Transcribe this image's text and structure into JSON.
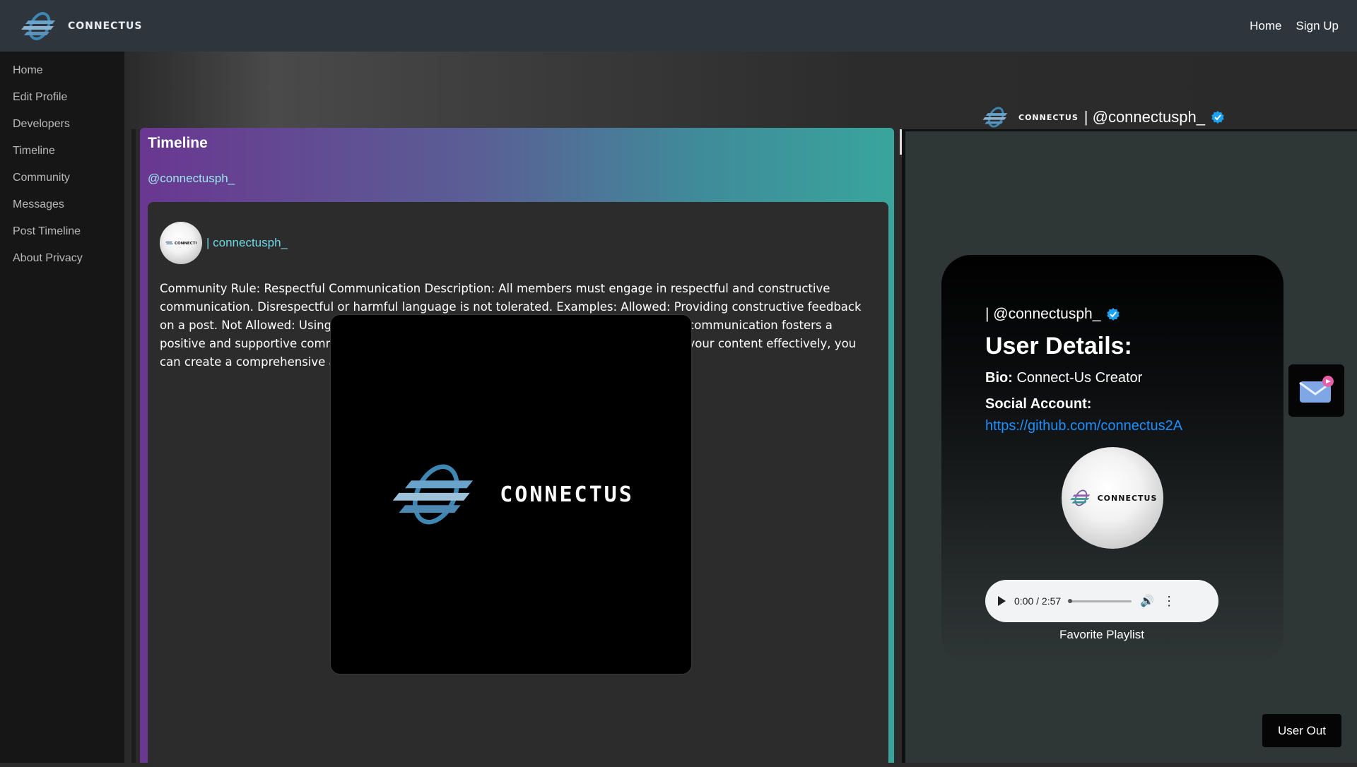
{
  "topbar": {
    "brand": "CONNECTUS",
    "nav": [
      "Home",
      "Sign Up"
    ]
  },
  "sidebar": {
    "items": [
      "Home",
      "Edit Profile",
      "Developers",
      "Timeline",
      "Community",
      "Messages",
      "Post Timeline",
      "About Privacy"
    ]
  },
  "banner": {
    "brand": "CONNECTUS",
    "handle": "| @connectusph_"
  },
  "timeline": {
    "title": "Timeline",
    "handle": "@connectusph_",
    "post": {
      "user": "| connectusph_",
      "avatar_text": "CONNECTUS",
      "text": "Community Rule: Respectful Communication Description: All members must engage in respectful and constructive communication. Disrespectful or harmful language is not tolerated. Examples: Allowed: Providing constructive feedback on a post. Not Allowed: Using derogatory terms or personal attacks. Rationale: Respectful communication fosters a positive and supportive community environment. By following these steps and organizing your content effectively, you can create a comprehensive and user-friendly general rules website.",
      "image_text": "CONNECTUS"
    }
  },
  "profile_card": {
    "handle": "| @connectusph_",
    "heading": "User Details:",
    "bio_label": "Bio:",
    "bio_value": "Connect-Us Creator",
    "social_label": "Social Account:",
    "social_link": "https://github.com/connectus2A",
    "avatar_text": "CONNECTUS",
    "audio": {
      "time": "0:00 / 2:57"
    },
    "playlist_label": "Favorite Playlist"
  },
  "buttons": {
    "user_out": "User Out"
  },
  "colors": {
    "accent_link": "#1e8fff",
    "handle_cyan": "#6fd9e8",
    "verified": "#1da1f2"
  }
}
